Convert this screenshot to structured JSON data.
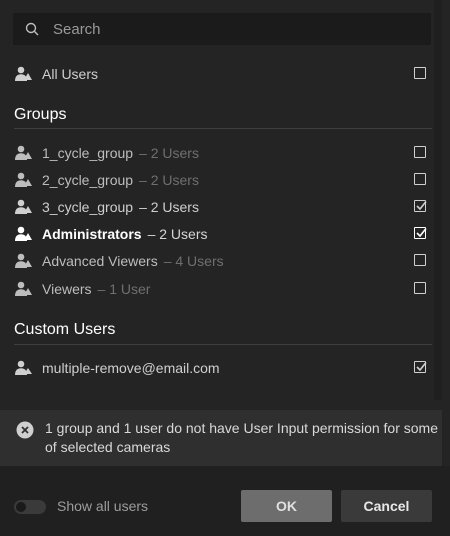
{
  "search": {
    "placeholder": "Search",
    "value": ""
  },
  "all_users": {
    "label": "All Users",
    "checked": false
  },
  "groups": {
    "title": "Groups",
    "items": [
      {
        "label": "1_cycle_group",
        "count": "– 2 Users",
        "checked": false,
        "style": "dim"
      },
      {
        "label": "2_cycle_group",
        "count": "– 2 Users",
        "checked": false,
        "style": "dim"
      },
      {
        "label": "3_cycle_group",
        "count": "– 2 Users",
        "checked": true,
        "style": "mid"
      },
      {
        "label": "Administrators",
        "count": "– 2 Users",
        "checked": true,
        "style": "bright"
      },
      {
        "label": "Advanced Viewers",
        "count": "– 4 Users",
        "checked": false,
        "style": "dim"
      },
      {
        "label": "Viewers",
        "count": "– 1 User",
        "checked": false,
        "style": "dim"
      }
    ]
  },
  "custom_users": {
    "title": "Custom Users",
    "items": [
      {
        "label": "multiple-remove@email.com",
        "checked": true
      }
    ]
  },
  "warning": {
    "message": "1 group and 1 user do not have User Input permission for some of selected cameras"
  },
  "footer": {
    "show_all_label": "Show all users",
    "show_all_on": false,
    "ok_label": "OK",
    "cancel_label": "Cancel"
  },
  "colors": {
    "background": "#242424",
    "warning_bg": "#2f2f2f",
    "footer_bg": "#202020",
    "ok_button": "#6d6d6d",
    "cancel_button": "#3a3a3a"
  },
  "icons": {
    "search": "search-icon",
    "group": "user-group-icon",
    "user": "user-icon",
    "warning": "close-circle-icon",
    "checkbox": "check-icon"
  }
}
